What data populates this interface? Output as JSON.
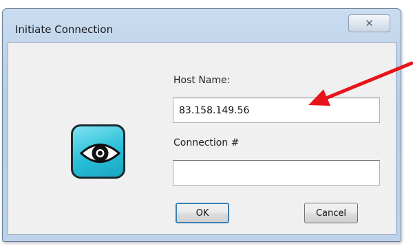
{
  "window": {
    "title": "Initiate Connection",
    "close_icon": "close-icon",
    "close_glyph": "✕"
  },
  "form": {
    "host_label": "Host Name:",
    "host_value": "83.158.149.56",
    "connection_label": "Connection #",
    "connection_value": ""
  },
  "buttons": {
    "ok_label": "OK",
    "cancel_label": "Cancel"
  },
  "app_icon": "eye-icon",
  "annotation": {
    "arrow_color": "#e8141b",
    "arrow_icon": "arrow-icon"
  },
  "colors": {
    "titlebar": "#bdd2ea",
    "client_bg": "#f0f0f0",
    "icon_accent": "#29bfd8"
  }
}
